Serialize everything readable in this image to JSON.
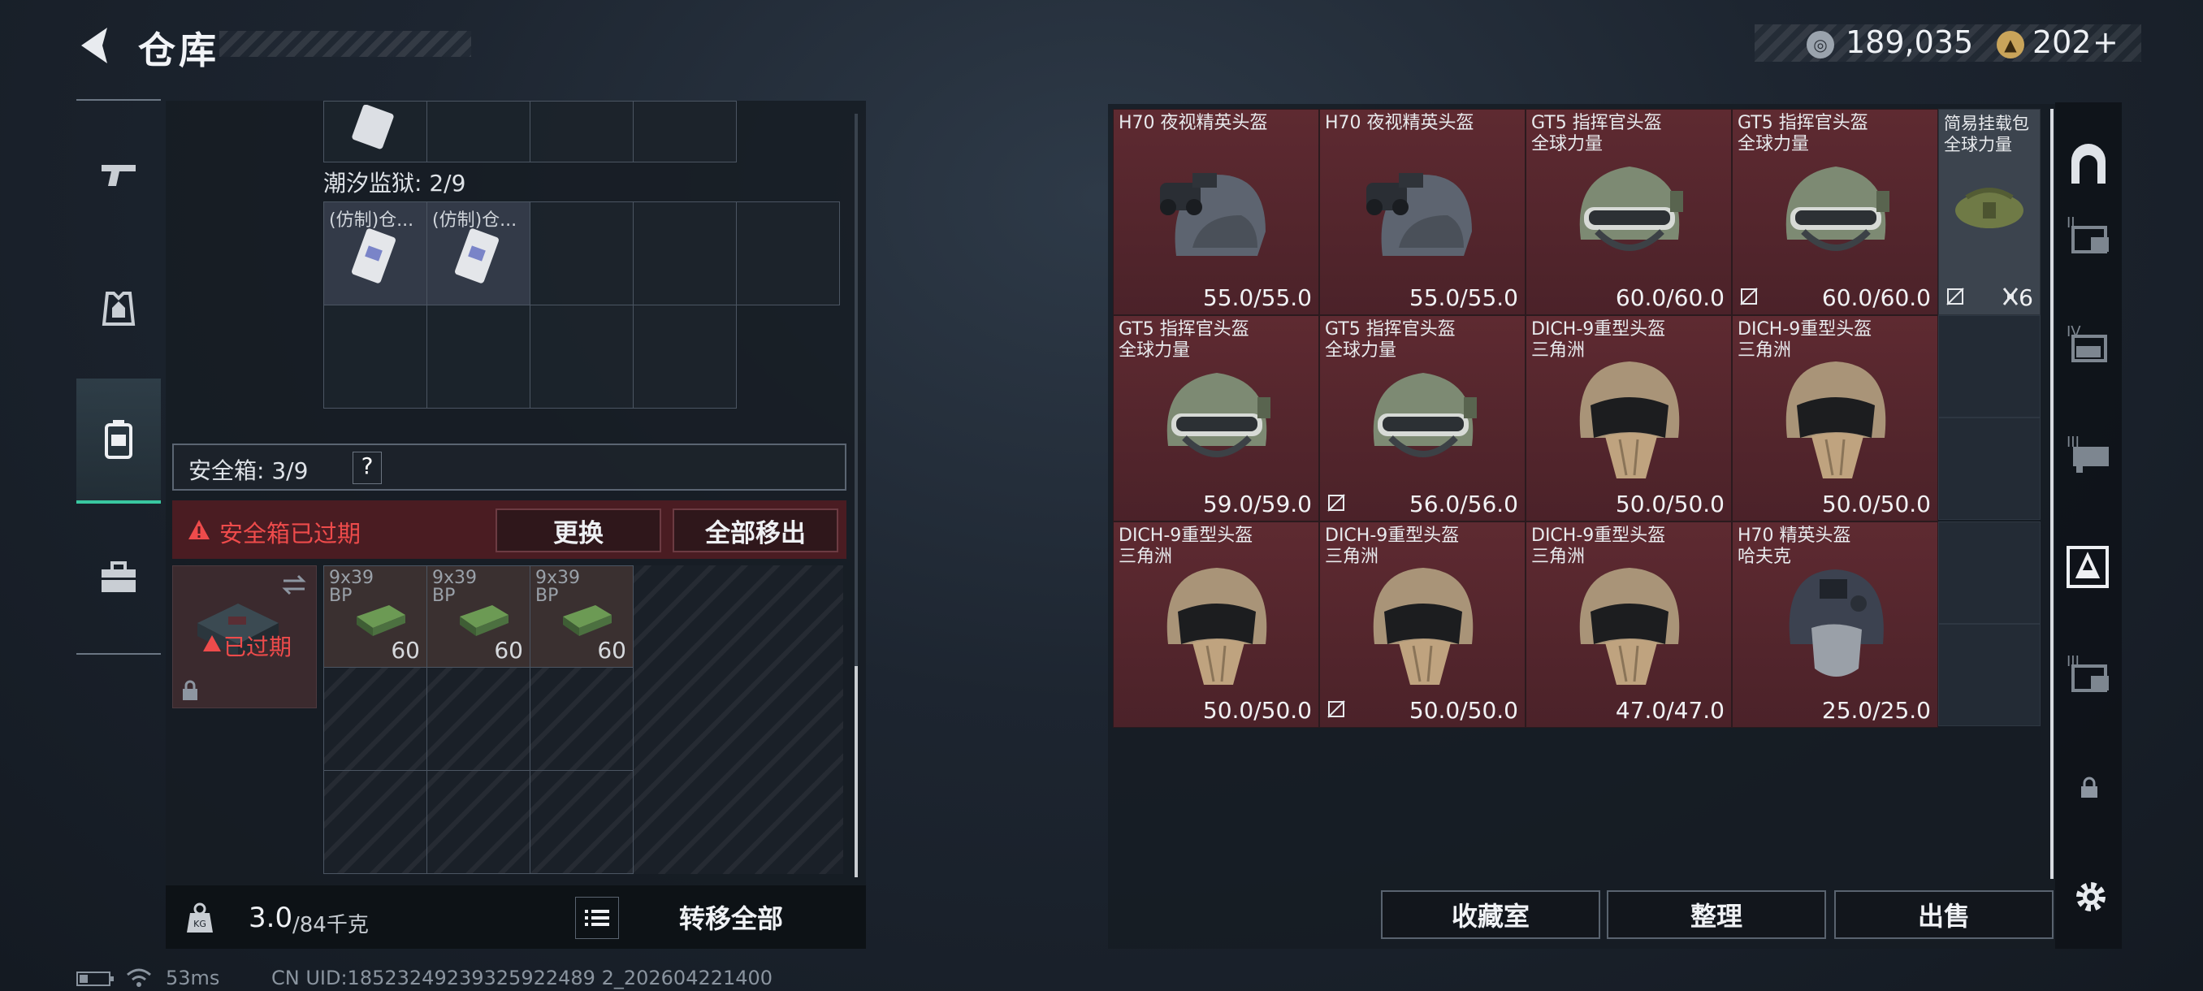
{
  "header": {
    "title": "仓库"
  },
  "currency": {
    "coins": "189,035",
    "tokens": "202",
    "plus": "+"
  },
  "left_panel": {
    "top_grid_label": "潮汐监狱: 2/9",
    "prison_items": [
      "(仿制)仓...",
      "(仿制)仓..."
    ],
    "safe_box": {
      "label": "安全箱: 3/9",
      "help": "?"
    },
    "alert": {
      "text": "安全箱已过期",
      "replace_btn": "更换",
      "remove_all_btn": "全部移出"
    },
    "expired_tag": "已过期",
    "ammo": [
      {
        "name": "9x39\nBP",
        "count": "60"
      },
      {
        "name": "9x39\nBP",
        "count": "60"
      },
      {
        "name": "9x39\nBP",
        "count": "60"
      }
    ],
    "weight": {
      "current": "3.0",
      "max": "/84千克"
    },
    "transfer_all": "转移全部"
  },
  "items": [
    {
      "name": "H70 夜视精英头盔",
      "value": "55.0/55.0",
      "type": "nv"
    },
    {
      "name": "H70 夜视精英头盔",
      "value": "55.0/55.0",
      "type": "nv"
    },
    {
      "name": "GT5 指挥官头盔\n全球力量",
      "value": "60.0/60.0",
      "type": "gt5"
    },
    {
      "name": "GT5 指挥官头盔\n全球力量",
      "value": "60.0/60.0",
      "type": "gt5",
      "nobag": true
    },
    {
      "name": "GT5 指挥官头盔\n全球力量",
      "value": "59.0/59.0",
      "type": "gt5"
    },
    {
      "name": "GT5 指挥官头盔\n全球力量",
      "value": "56.0/56.0",
      "type": "gt5",
      "nobag": true
    },
    {
      "name": "DICH-9重型头盔\n三角洲",
      "value": "50.0/50.0",
      "type": "dich"
    },
    {
      "name": "DICH-9重型头盔\n三角洲",
      "value": "50.0/50.0",
      "type": "dich"
    },
    {
      "name": "DICH-9重型头盔\n三角洲",
      "value": "50.0/50.0",
      "type": "dich"
    },
    {
      "name": "DICH-9重型头盔\n三角洲",
      "value": "50.0/50.0",
      "type": "dich",
      "nobag": true
    },
    {
      "name": "DICH-9重型头盔\n三角洲",
      "value": "47.0/47.0",
      "type": "dich"
    },
    {
      "name": "H70 精英头盔\n哈夫克",
      "value": "25.0/25.0",
      "type": "h70"
    }
  ],
  "bag_item": {
    "name": "简易挂载包\n全球力量",
    "count": "6"
  },
  "buttons": {
    "collection": "收藏室",
    "sort": "整理",
    "sell": "出售"
  },
  "status": {
    "ping": "53ms",
    "uid": "CN UID:18523249239325922489 2_202604221400"
  },
  "colors": {
    "accent": "#39c7a0",
    "item_bg": "#5e2a31",
    "alert_bg": "#4a1c22",
    "alert_text": "#e84a4a"
  }
}
